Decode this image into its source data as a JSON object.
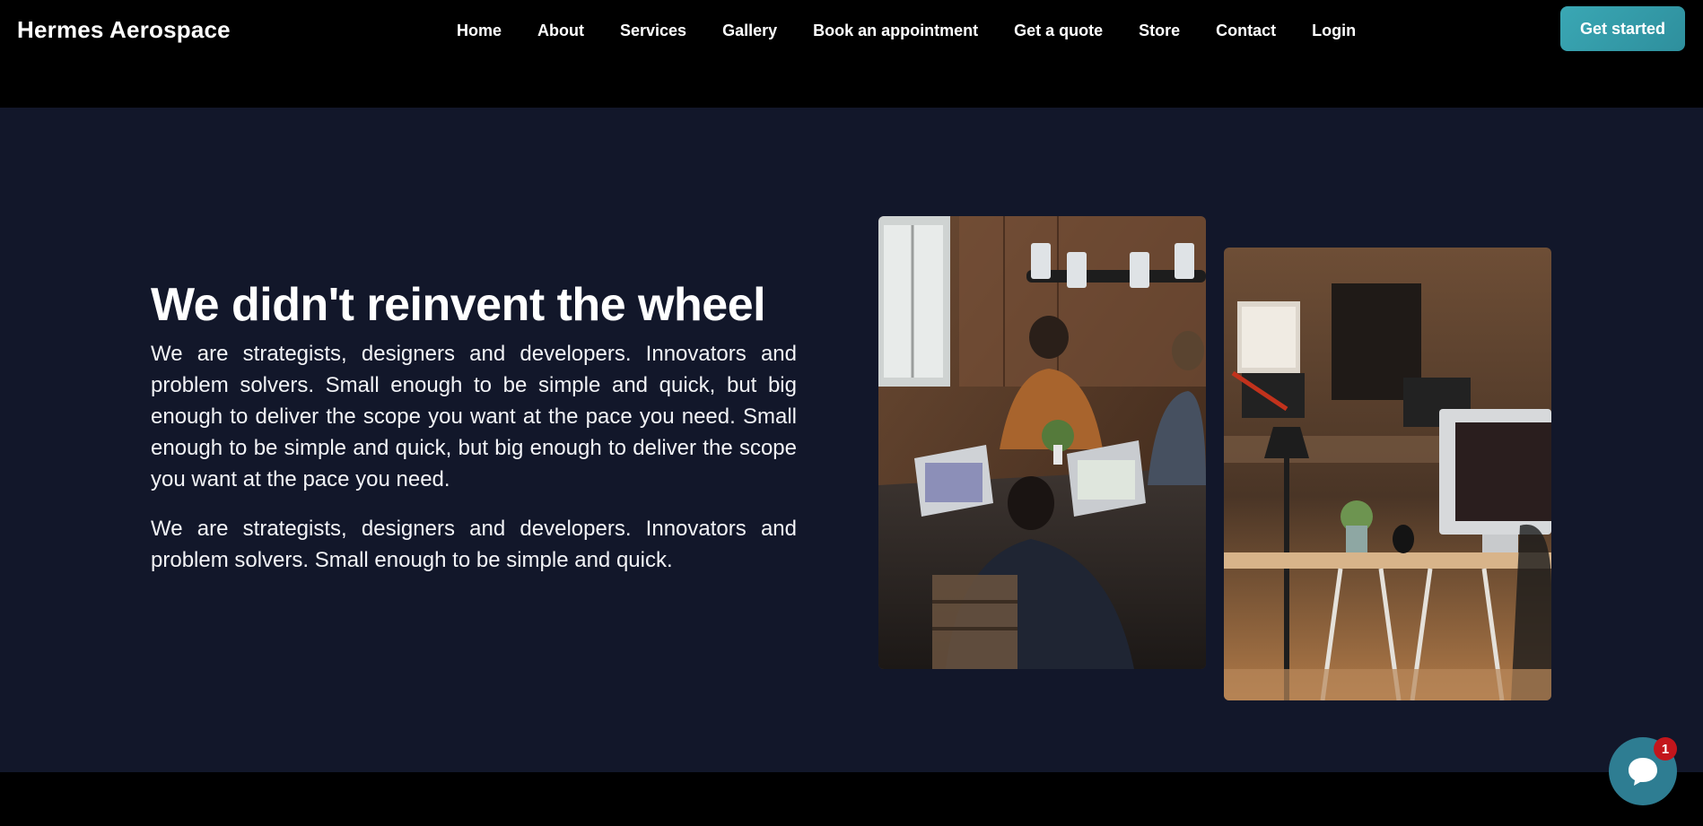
{
  "header": {
    "brand": "Hermes Aerospace",
    "nav": [
      "Home",
      "About",
      "Services",
      "Gallery",
      "Book an appointment",
      "Get a quote",
      "Store",
      "Contact",
      "Login"
    ],
    "cta_label": "Get started"
  },
  "hero": {
    "headline": "We didn't reinvent the wheel",
    "paragraph_1": "We are strategists, designers and developers. Innovators and problem solvers. Small enough to be simple and quick, but big enough to deliver the scope you want at the pace you need. Small enough to be simple and quick, but big enough to deliver the scope you want at the pace you need.",
    "paragraph_2": "We are strategists, designers and developers. Innovators and problem solvers. Small enough to be simple and quick."
  },
  "chat": {
    "icon": "chat-bubble-icon",
    "badge_count": "1"
  },
  "colors": {
    "header_bg": "#000000",
    "section_bg": "#12172a",
    "accent": "#3aa7b4",
    "badge": "#c3161c"
  }
}
